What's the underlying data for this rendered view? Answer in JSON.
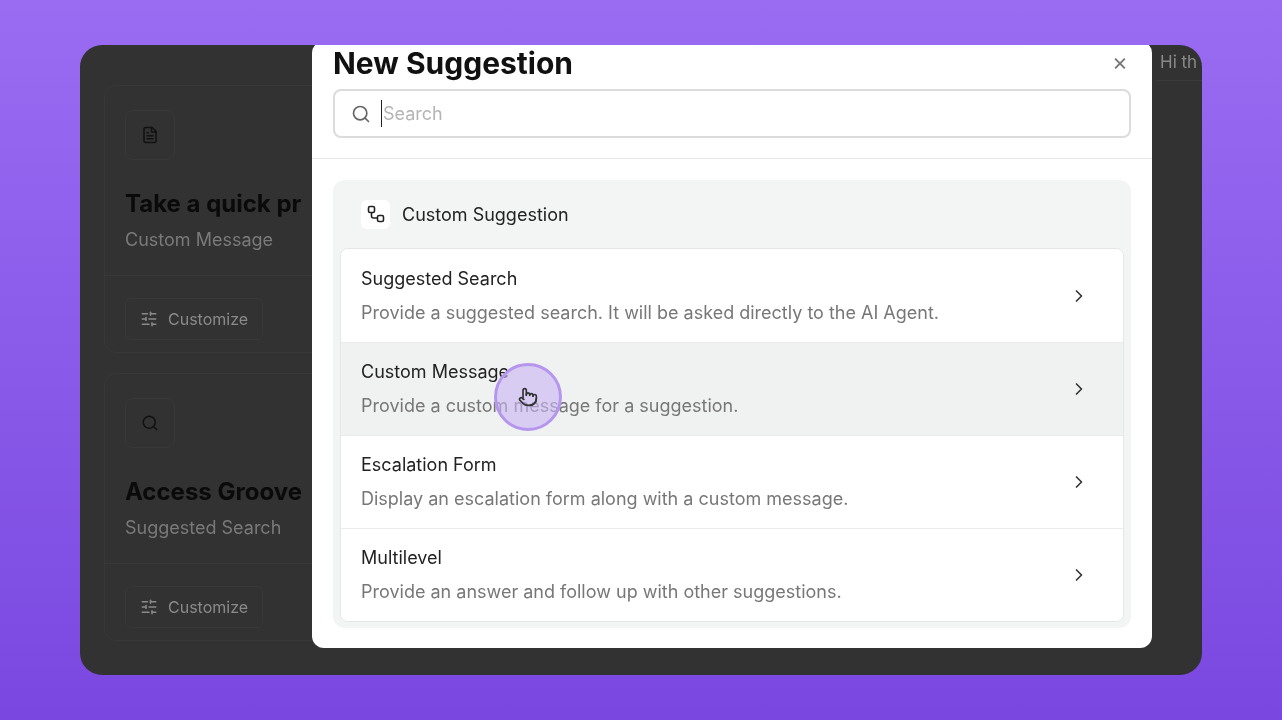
{
  "background_cards": [
    {
      "kind": "message",
      "title": "Take a quick pr",
      "subtitle": "Custom Message",
      "button": "Customize"
    },
    {
      "kind": "search",
      "title": "Access Groove",
      "subtitle": "Suggested Search",
      "button": "Customize"
    }
  ],
  "header_text": "Hi th",
  "dialog": {
    "title": "New Suggestion",
    "close": "×",
    "search": {
      "placeholder": "Search"
    },
    "group": {
      "title": "Custom Suggestion",
      "items": [
        {
          "title": "Suggested Search",
          "description": "Provide a suggested search. It will be asked directly to the AI Agent.",
          "highlighted": false
        },
        {
          "title": "Custom Message",
          "description": "Provide a custom message for a suggestion.",
          "highlighted": true
        },
        {
          "title": "Escalation Form",
          "description": "Display an escalation form along with a custom message.",
          "highlighted": false
        },
        {
          "title": "Multilevel",
          "description": "Provide an answer and follow up with other suggestions.",
          "highlighted": false
        }
      ]
    }
  }
}
